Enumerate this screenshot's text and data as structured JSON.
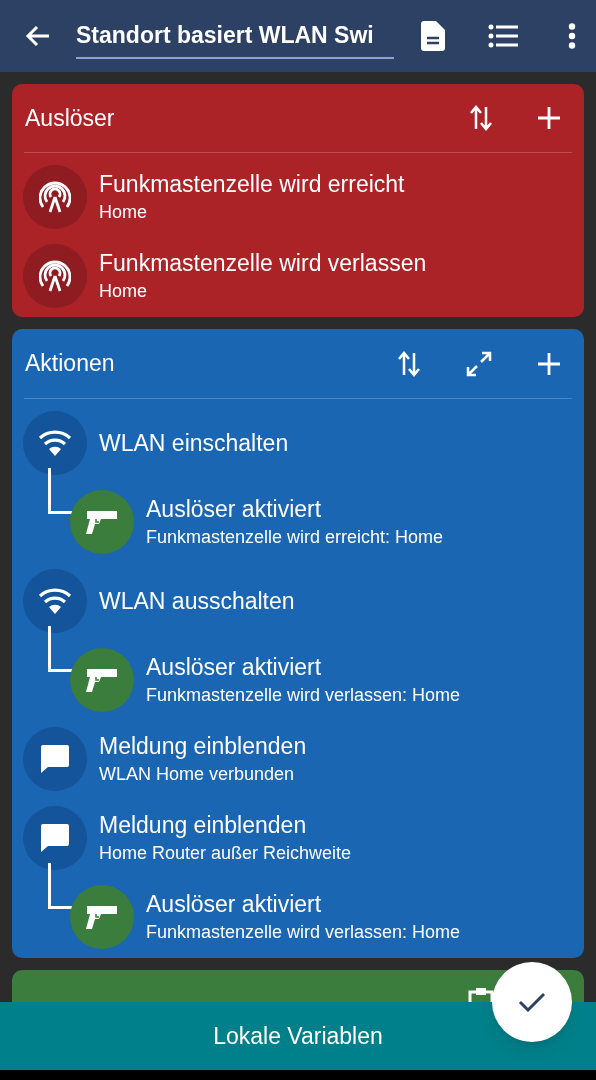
{
  "app_bar": {
    "title": "Standort basiert WLAN Swi"
  },
  "sections": [
    {
      "kind": "triggers",
      "title": "Auslöser",
      "items": [
        {
          "kind": "cell",
          "title": "Funkmastenzelle wird erreicht",
          "subtitle": "Home"
        },
        {
          "kind": "cell",
          "title": "Funkmastenzelle wird verlassen",
          "subtitle": "Home"
        }
      ]
    },
    {
      "kind": "actions",
      "title": "Aktionen",
      "items": [
        {
          "kind": "wifi",
          "title": "WLAN einschalten",
          "children": [
            {
              "kind": "constraint",
              "title": "Auslöser aktiviert",
              "subtitle": "Funkmastenzelle wird erreicht: Home"
            }
          ]
        },
        {
          "kind": "wifi",
          "title": "WLAN ausschalten",
          "children": [
            {
              "kind": "constraint",
              "title": "Auslöser aktiviert",
              "subtitle": "Funkmastenzelle wird verlassen: Home"
            }
          ]
        },
        {
          "kind": "message",
          "title": "Meldung einblenden",
          "subtitle": "WLAN Home verbunden"
        },
        {
          "kind": "message",
          "title": "Meldung einblenden",
          "subtitle": "Home Router außer Reichweite",
          "children": [
            {
              "kind": "constraint",
              "title": "Auslöser aktiviert",
              "subtitle": "Funkmastenzelle wird verlassen: Home"
            }
          ]
        }
      ]
    },
    {
      "kind": "conditions"
    }
  ],
  "bottom_bar": {
    "label": "Lokale Variablen"
  }
}
